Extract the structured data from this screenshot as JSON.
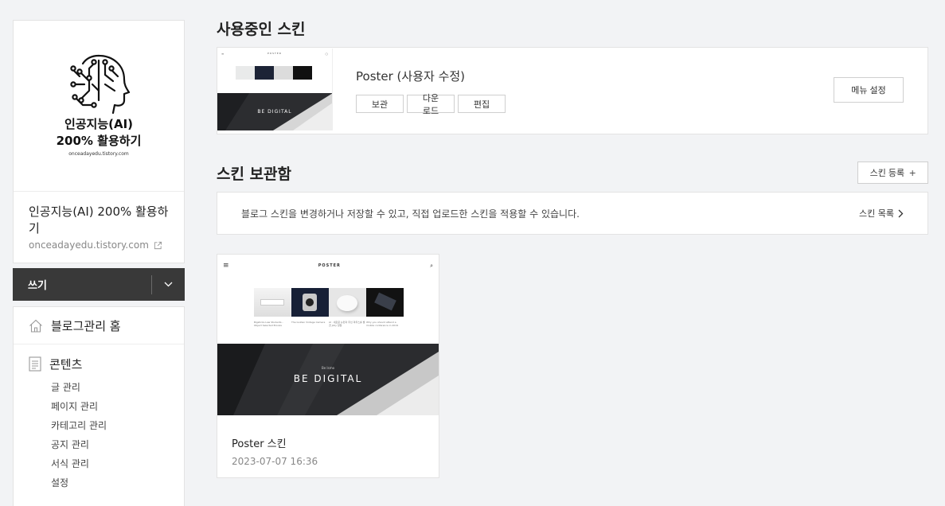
{
  "sidebar": {
    "logo_title_line1": "인공지능(AI)",
    "logo_title_line2": "200% 활용하기",
    "logo_url": "onceadayedu.tistory.com",
    "blog_title": "인공지능(AI) 200% 활용하기",
    "blog_url": "onceadayedu.tistory.com",
    "write_label": "쓰기",
    "home_label": "블로그관리 홈",
    "content_label": "콘텐츠",
    "content_items": [
      "글 관리",
      "페이지 관리",
      "카테고리 관리",
      "공지 관리",
      "서식 관리",
      "설정"
    ]
  },
  "main": {
    "current_title": "사용중인 스킨",
    "current_skin_name": "Poster (사용자 수정)",
    "current_actions": [
      "보관",
      "다운로드",
      "편집"
    ],
    "menu_setting_label": "메뉴 설정",
    "storage_title": "스킨 보관함",
    "register_label": "스킨 등록",
    "notice_text": "블로그 스킨을 변경하거나 저장할 수 있고, 직접 업로드한 스킨을 적용할 수 있습니다.",
    "skin_list_label": "스킨 목록",
    "card": {
      "name": "Poster 스킨",
      "date": "2023-07-07 16:36",
      "preview_logo": "POSTER",
      "preview_hero_kicker": "Be Ismo",
      "preview_hero": "BE DIGITAL",
      "preview_captions": [
        "Bigsticks Law Students - Object Selected Brooks",
        "The Golden Vintage Camera",
        "AI · 새로운 뉴턴의 무선 마우스를 발견 Jolly 정말",
        "Why you should attend a mobile conference in 2019"
      ]
    }
  },
  "colors": {
    "background": "#f2f3f5",
    "write_button": "#393939"
  }
}
